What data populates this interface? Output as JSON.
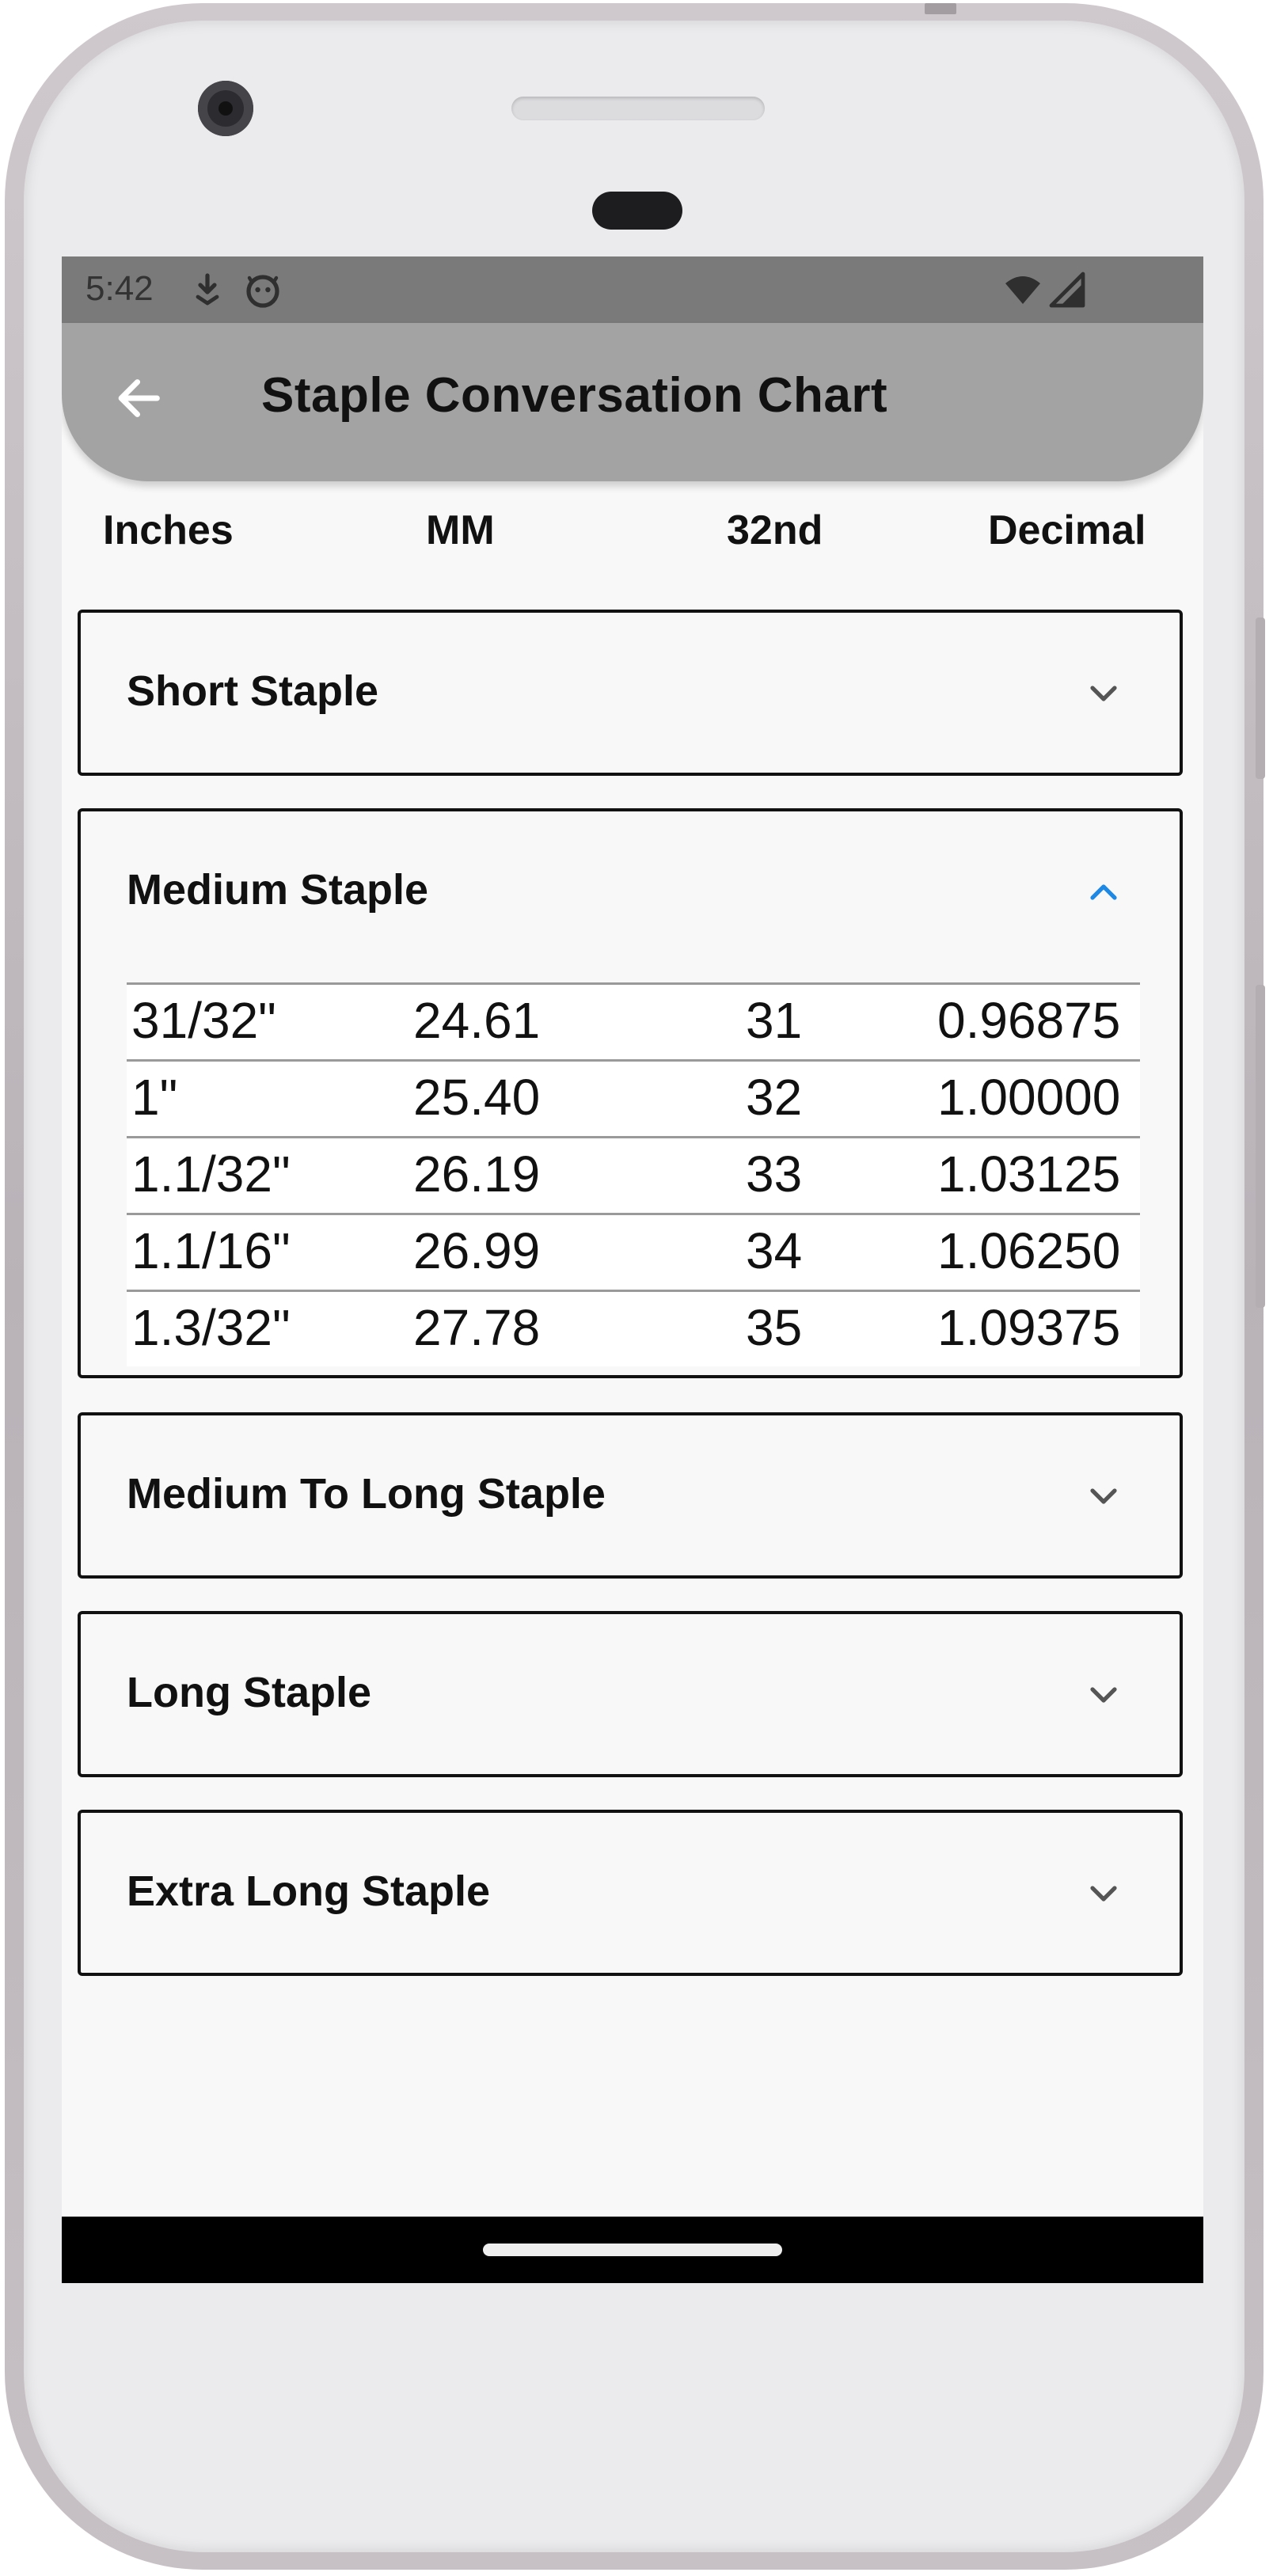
{
  "status_bar": {
    "time": "5:42",
    "icons": [
      "download-arrow-icon",
      "android-face-icon",
      "wifi-icon",
      "cell-signal-icon"
    ]
  },
  "app_bar": {
    "back_icon": "arrow-back-icon",
    "title": "Staple Conversation Chart"
  },
  "columns": {
    "inches": "Inches",
    "mm": "MM",
    "thirty_second": "32nd",
    "decimal": "Decimal"
  },
  "panels": [
    {
      "title": "Short Staple",
      "expanded": false,
      "icon": "chevron-down-icon"
    },
    {
      "title": "Medium Staple",
      "expanded": true,
      "icon": "chevron-up-icon",
      "rows": [
        {
          "inches": "31/32\"",
          "mm": "24.61",
          "thirty_second": "31",
          "decimal": "0.96875"
        },
        {
          "inches": "1\"",
          "mm": "25.40",
          "thirty_second": "32",
          "decimal": "1.00000"
        },
        {
          "inches": "1.1/32\"",
          "mm": "26.19",
          "thirty_second": "33",
          "decimal": "1.03125"
        },
        {
          "inches": "1.1/16\"",
          "mm": "26.99",
          "thirty_second": "34",
          "decimal": "1.06250"
        },
        {
          "inches": "1.3/32\"",
          "mm": "27.78",
          "thirty_second": "35",
          "decimal": "1.09375"
        }
      ]
    },
    {
      "title": "Medium To Long Staple",
      "expanded": false,
      "icon": "chevron-down-icon"
    },
    {
      "title": "Long Staple",
      "expanded": false,
      "icon": "chevron-down-icon"
    },
    {
      "title": "Extra Long Staple",
      "expanded": false,
      "icon": "chevron-down-icon"
    }
  ],
  "colors": {
    "status_bar": "#7a7a7a",
    "app_bar": "#a3a3a3",
    "expanded_chevron": "#1e88e5",
    "collapsed_chevron": "#555555",
    "nav_bar": "#000000"
  }
}
